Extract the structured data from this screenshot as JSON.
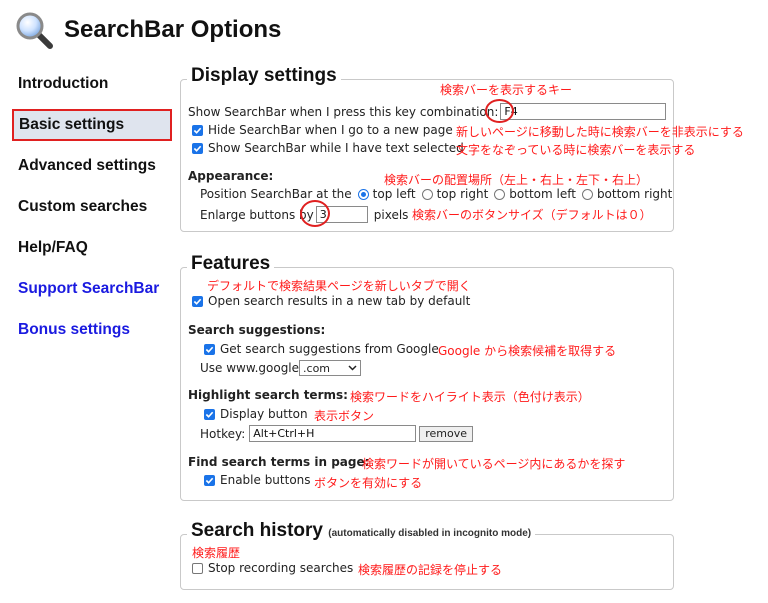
{
  "app": {
    "title": "SearchBar Options",
    "logo_icon": "magnifier-icon"
  },
  "nav": {
    "items": [
      {
        "label": "Introduction",
        "selected": false,
        "color": "#111111"
      },
      {
        "label": "Basic settings",
        "selected": true,
        "color": "#111111"
      },
      {
        "label": "Advanced settings",
        "selected": false,
        "color": "#111111"
      },
      {
        "label": "Custom searches",
        "selected": false,
        "color": "#111111"
      },
      {
        "label": "Help/FAQ",
        "selected": false,
        "color": "#111111"
      },
      {
        "label": "Support SearchBar",
        "selected": false,
        "color": "#1a1ae0"
      },
      {
        "label": "Bonus settings",
        "selected": false,
        "color": "#1a1ae0"
      }
    ]
  },
  "display": {
    "legend": "Display settings",
    "key_label": "Show SearchBar when I press this key combination:",
    "key_value": "F4",
    "hide_label": "Hide SearchBar when I go to a new page",
    "hide_checked": true,
    "show_text_label": "Show SearchBar while I have text selected",
    "show_text_checked": true,
    "appearance_title": "Appearance:",
    "position_label": "Position SearchBar at the",
    "position_options": [
      "top left",
      "top right",
      "bottom left",
      "bottom right"
    ],
    "position_selected": "top left",
    "enlarge_label": "Enlarge buttons by",
    "enlarge_value": "3",
    "enlarge_unit": "pixels"
  },
  "features": {
    "legend": "Features",
    "new_tab_label": "Open search results in a new tab by default",
    "new_tab_checked": true,
    "suggestions_title": "Search suggestions:",
    "suggestions_label": "Get search suggestions from Google",
    "suggestions_checked": true,
    "use_label": "Use www.google",
    "domain_value": ".com",
    "highlight_title": "Highlight search terms:",
    "display_button_label": "Display button",
    "display_button_checked": true,
    "hotkey_label": "Hotkey:",
    "hotkey_value": "Alt+Ctrl+H",
    "remove_label": "remove",
    "find_title": "Find search terms in page:",
    "enable_buttons_label": "Enable buttons",
    "enable_buttons_checked": true
  },
  "history": {
    "legend": "Search history",
    "legend_note": "(automatically disabled in incognito mode)",
    "stop_label": "Stop recording searches",
    "stop_checked": false
  },
  "annotations": {
    "color": "#ff1a1a",
    "key": "検索バーを表示するキー",
    "hide": "新しいページに移動した時に検索バーを非表示にする",
    "show_text": "文字をなぞっている時に検索バーを表示する",
    "position": "検索バーの配置場所（左上・右上・左下・右上）",
    "enlarge": "検索バーのボタンサイズ（デフォルトは０）",
    "new_tab": "デフォルトで検索結果ページを新しいタブで開く",
    "suggestions": "Google から検索候補を取得する",
    "highlight": "検索ワードをハイライト表示（色付け表示）",
    "display_button": "表示ボタン",
    "find": "検索ワードが開いているページ内にあるかを探す",
    "enable_buttons": "ボタンを有効にする",
    "history": "検索履歴",
    "stop": "検索履歴の記録を停止する"
  }
}
